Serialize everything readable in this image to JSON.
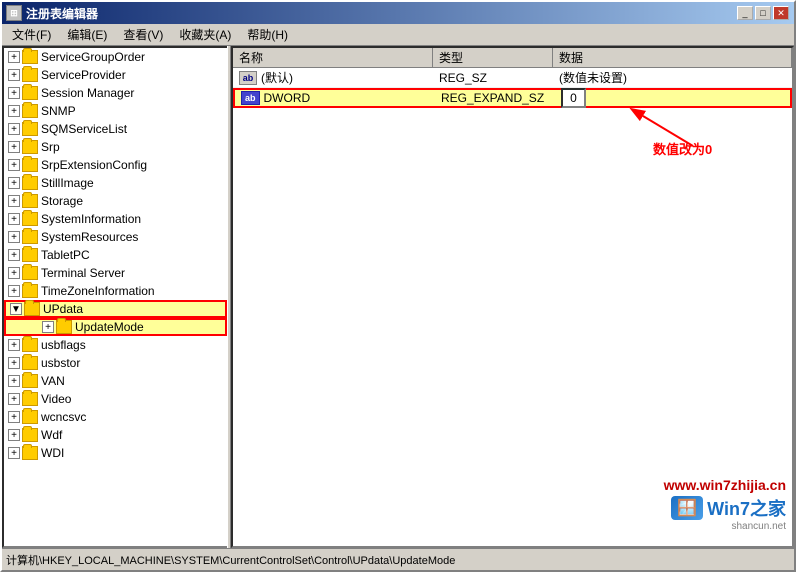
{
  "window": {
    "title": "注册表编辑器",
    "icon": "reg"
  },
  "menu": {
    "items": [
      "文件(F)",
      "编辑(E)",
      "查看(V)",
      "收藏夹(A)",
      "帮助(H)"
    ]
  },
  "tree": {
    "items": [
      {
        "label": "ServiceGroupOrder",
        "indent": 1,
        "expanded": false,
        "selected": false
      },
      {
        "label": "ServiceProvider",
        "indent": 1,
        "expanded": false,
        "selected": false
      },
      {
        "label": "Session Manager",
        "indent": 1,
        "expanded": false,
        "selected": false
      },
      {
        "label": "SNMP",
        "indent": 1,
        "expanded": false,
        "selected": false
      },
      {
        "label": "SQMServiceList",
        "indent": 1,
        "expanded": false,
        "selected": false
      },
      {
        "label": "Srp",
        "indent": 1,
        "expanded": false,
        "selected": false
      },
      {
        "label": "SrpExtensionConfig",
        "indent": 1,
        "expanded": false,
        "selected": false
      },
      {
        "label": "StillImage",
        "indent": 1,
        "expanded": false,
        "selected": false
      },
      {
        "label": "Storage",
        "indent": 1,
        "expanded": false,
        "selected": false
      },
      {
        "label": "SystemInformation",
        "indent": 1,
        "expanded": false,
        "selected": false
      },
      {
        "label": "SystemResources",
        "indent": 1,
        "expanded": false,
        "selected": false
      },
      {
        "label": "TabletPC",
        "indent": 1,
        "expanded": false,
        "selected": false
      },
      {
        "label": "Terminal Server",
        "indent": 1,
        "expanded": false,
        "selected": false
      },
      {
        "label": "TimeZoneInformation",
        "indent": 1,
        "expanded": false,
        "selected": false
      },
      {
        "label": "UPdata",
        "indent": 1,
        "expanded": true,
        "selected": true,
        "highlighted": true
      },
      {
        "label": "UpdateMode",
        "indent": 2,
        "expanded": false,
        "selected": true,
        "highlighted": true
      },
      {
        "label": "usbflags",
        "indent": 1,
        "expanded": false,
        "selected": false
      },
      {
        "label": "usbstor",
        "indent": 1,
        "expanded": false,
        "selected": false
      },
      {
        "label": "VAN",
        "indent": 1,
        "expanded": false,
        "selected": false
      },
      {
        "label": "Video",
        "indent": 1,
        "expanded": false,
        "selected": false
      },
      {
        "label": "wcncsvc",
        "indent": 1,
        "expanded": false,
        "selected": false
      },
      {
        "label": "Wdf",
        "indent": 1,
        "expanded": false,
        "selected": false
      },
      {
        "label": "WDI",
        "indent": 1,
        "expanded": false,
        "selected": false
      }
    ]
  },
  "columns": {
    "name": "名称",
    "type": "类型",
    "data": "数据"
  },
  "values": [
    {
      "name": "(默认)",
      "type": "REG_SZ",
      "data": "(数值未设置)",
      "icon": "ab",
      "default": true
    },
    {
      "name": "DWORD",
      "type": "REG_EXPAND_SZ",
      "data": "0",
      "icon": "dword",
      "highlighted": true
    }
  ],
  "annotation": {
    "label": "数值改为0"
  },
  "status_bar": {
    "path": "计算机\\HKEY_LOCAL_MACHINE\\SYSTEM\\CurrentControlSet\\Control\\UPdata\\UpdateMode"
  },
  "watermark": {
    "url": "www.win7zhijia.cn",
    "brand": "Win7",
    "suffix": "之家",
    "shancun": "shancun.net"
  }
}
